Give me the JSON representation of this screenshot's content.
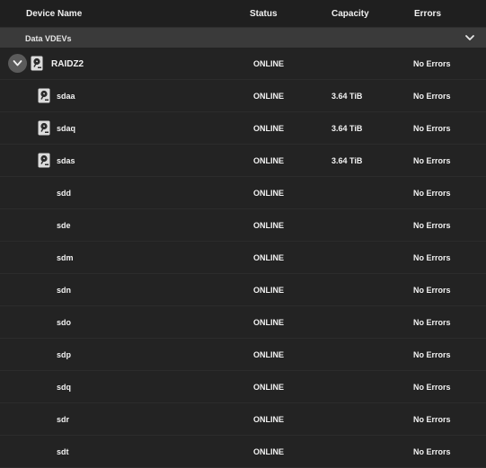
{
  "header": {
    "device_name": "Device Name",
    "status": "Status",
    "capacity": "Capacity",
    "errors": "Errors"
  },
  "group": {
    "label": "Data VDEVs"
  },
  "root": {
    "name": "RAIDZ2",
    "status": "ONLINE",
    "errors": "No Errors"
  },
  "disks": [
    {
      "name": "sdaa",
      "status": "ONLINE",
      "capacity": "3.64 TiB",
      "errors": "No Errors"
    },
    {
      "name": "sdaq",
      "status": "ONLINE",
      "capacity": "3.64 TiB",
      "errors": "No Errors"
    },
    {
      "name": "sdas",
      "status": "ONLINE",
      "capacity": "3.64 TiB",
      "errors": "No Errors"
    },
    {
      "name": "sdd",
      "status": "ONLINE",
      "capacity": "",
      "errors": "No Errors"
    },
    {
      "name": "sde",
      "status": "ONLINE",
      "capacity": "",
      "errors": "No Errors"
    },
    {
      "name": "sdm",
      "status": "ONLINE",
      "capacity": "",
      "errors": "No Errors"
    },
    {
      "name": "sdn",
      "status": "ONLINE",
      "capacity": "",
      "errors": "No Errors"
    },
    {
      "name": "sdo",
      "status": "ONLINE",
      "capacity": "",
      "errors": "No Errors"
    },
    {
      "name": "sdp",
      "status": "ONLINE",
      "capacity": "",
      "errors": "No Errors"
    },
    {
      "name": "sdq",
      "status": "ONLINE",
      "capacity": "",
      "errors": "No Errors"
    },
    {
      "name": "sdr",
      "status": "ONLINE",
      "capacity": "",
      "errors": "No Errors"
    },
    {
      "name": "sdt",
      "status": "ONLINE",
      "capacity": "",
      "errors": "No Errors"
    }
  ]
}
